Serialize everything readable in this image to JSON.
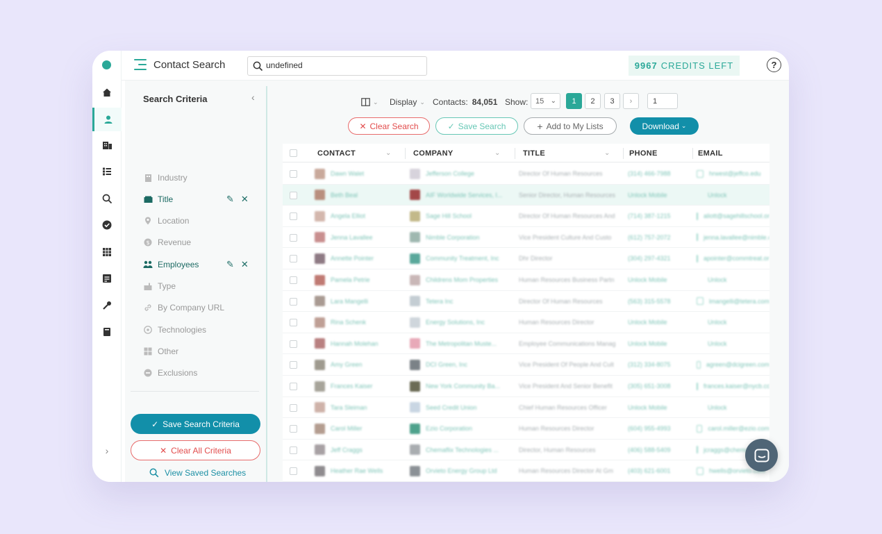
{
  "header": {
    "title": "Contact Search",
    "search_value": "undefined",
    "credits_number": "9967",
    "credits_label": "CREDITS LEFT",
    "help_label": "?"
  },
  "rail": {
    "items": [
      "home-icon",
      "contact-icon",
      "company-icon",
      "list-icon",
      "search-icon",
      "check-icon",
      "table-icon",
      "report-icon",
      "tools-icon",
      "book-icon"
    ],
    "active": "contact-icon",
    "expand_label": "›"
  },
  "criteria": {
    "title": "Search Criteria",
    "collapse_label": "‹",
    "items": [
      {
        "label": "Industry",
        "active": false
      },
      {
        "label": "Title",
        "active": true
      },
      {
        "label": "Location",
        "active": false
      },
      {
        "label": "Revenue",
        "active": false
      },
      {
        "label": "Employees",
        "active": true
      },
      {
        "label": "Type",
        "active": false
      },
      {
        "label": "By Company URL",
        "active": false
      },
      {
        "label": "Technologies",
        "active": false
      },
      {
        "label": "Other",
        "active": false
      },
      {
        "label": "Exclusions",
        "active": false
      }
    ],
    "save_label": "Save Search Criteria",
    "clear_label": "Clear All Criteria",
    "view_saved_label": "View Saved Searches"
  },
  "toolbar": {
    "display_label": "Display",
    "contacts_label": "Contacts:",
    "contacts_count": "84,051",
    "show_label": "Show:",
    "show_value": "15",
    "pages": [
      "1",
      "2",
      "3"
    ],
    "active_page": "1",
    "next_label": "›",
    "page_input": "1"
  },
  "actions": {
    "clear_search": "Clear Search",
    "save_search": "Save Search",
    "add_to_list": "Add to My Lists",
    "download": "Download"
  },
  "table": {
    "columns": [
      "CONTACT",
      "COMPANY",
      "TITLE",
      "PHONE",
      "EMAIL"
    ],
    "rows": [
      {
        "contact": "Dawn Walet",
        "company": "Jefferson College",
        "title": "Director Of Human Resources",
        "phone": "(314) 466-7988",
        "email": "hrwest@jeffco.edu"
      },
      {
        "contact": "Beth Beal",
        "company": "AIF Worldwide Services, I...",
        "title": "Senior Director, Human Resources",
        "phone": "Unlock Mobile",
        "email": "Unlock"
      },
      {
        "contact": "Angela Elliot",
        "company": "Sage Hill School",
        "title": "Director Of Human Resources And",
        "phone": "(714) 387-1215",
        "email": "aliott@sagehillschool.org"
      },
      {
        "contact": "Jenna Lavallee",
        "company": "Nimble Corporation",
        "title": "Vice President Culture And Custo",
        "phone": "(612) 757-2072",
        "email": "jenna.lavallee@nimble.com"
      },
      {
        "contact": "Annette Pointer",
        "company": "Community Treatment, Inc",
        "title": "Dhr Director",
        "phone": "(304) 297-4321",
        "email": "apointer@commtreat.org"
      },
      {
        "contact": "Pamela Petrie",
        "company": "Childrens Mom Properties",
        "title": "Human Resources Business Partn",
        "phone": "Unlock Mobile",
        "email": "Unlock"
      },
      {
        "contact": "Lara Mangelli",
        "company": "Tetera Inc",
        "title": "Director Of Human Resources",
        "phone": "(563) 315-5578",
        "email": "lmangelli@tetera.com"
      },
      {
        "contact": "Rina Schenk",
        "company": "Energy Solutions, Inc",
        "title": "Human Resources Director",
        "phone": "Unlock Mobile",
        "email": "Unlock"
      },
      {
        "contact": "Hannah Molehan",
        "company": "The Metropolitan Muste...",
        "title": "Employee Communications Manag",
        "phone": "Unlock Mobile",
        "email": "Unlock"
      },
      {
        "contact": "Amy Green",
        "company": "DCI Green, Inc",
        "title": "Vice President Of People And Cult",
        "phone": "(312) 334-8075",
        "email": "agreen@dcigreen.com"
      },
      {
        "contact": "Frances Kaiser",
        "company": "New York Community Ba...",
        "title": "Vice President And Senior Benefit",
        "phone": "(305) 651-3008",
        "email": "frances.kaiser@nycb.com"
      },
      {
        "contact": "Tara Sleiman",
        "company": "Seed Credit Union",
        "title": "Chief Human Resources Officer",
        "phone": "Unlock Mobile",
        "email": "Unlock"
      },
      {
        "contact": "Carol Miller",
        "company": "Ezio Corporation",
        "title": "Human Resources Director",
        "phone": "(604) 955-4993",
        "email": "carol.miller@ezio.com"
      },
      {
        "contact": "Jeff Craggs",
        "company": "Chemaflix Technologies ...",
        "title": "Director, Human Resources",
        "phone": "(406) 588-5409",
        "email": "jcraggs@chemaflix.com"
      },
      {
        "contact": "Heather Rae Wells",
        "company": "Orvieto Energy Group Ltd",
        "title": "Human Resources Director At Gm",
        "phone": "(403) 621-6001",
        "email": "hwells@orvieto.com"
      }
    ]
  },
  "colors": {
    "accent": "#2aa898",
    "primary": "#128fa9",
    "danger": "#e24c4c",
    "background": "#e9e6fb"
  }
}
